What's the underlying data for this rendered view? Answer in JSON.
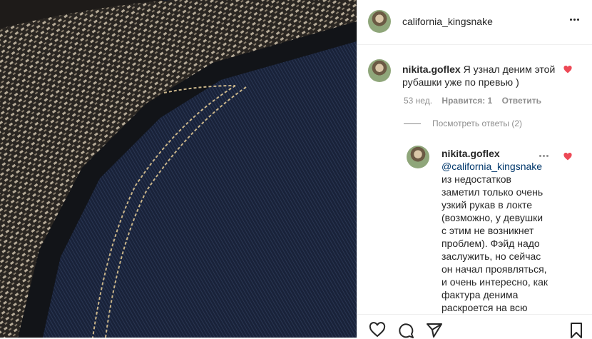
{
  "post": {
    "photo_alt": "",
    "header": {
      "username": "california_kingsnake",
      "more_icon": "more-horizontal-icon"
    },
    "comments": [
      {
        "username": "nikita.goflex",
        "text": "Я узнал деним этой рубашки уже по превью )",
        "time": "53 нед.",
        "likes": "Нравится: 1",
        "reply": "Ответить",
        "liked": true,
        "view_replies": "Посмотреть ответы (2)"
      }
    ],
    "reply": {
      "username": "nikita.goflex",
      "mention": "@california_kingsnake",
      "text": "из недостатков заметил только очень узкий рукав в локте (возможно, у девушки с этим не возникнет проблем). Фэйд надо заслужить, но сейчас он начал проявляться, и очень интересно, как фактура денима раскроется на всю",
      "liked": true
    },
    "actions": {
      "like_icon": "heart-outline-icon",
      "comment_icon": "comment-icon",
      "share_icon": "paper-plane-icon",
      "save_icon": "bookmark-icon"
    },
    "colors": {
      "heart": "#ed4956",
      "text": "#262626",
      "meta": "#8e8e8e",
      "mention": "#00376b",
      "border": "#efefef"
    }
  }
}
